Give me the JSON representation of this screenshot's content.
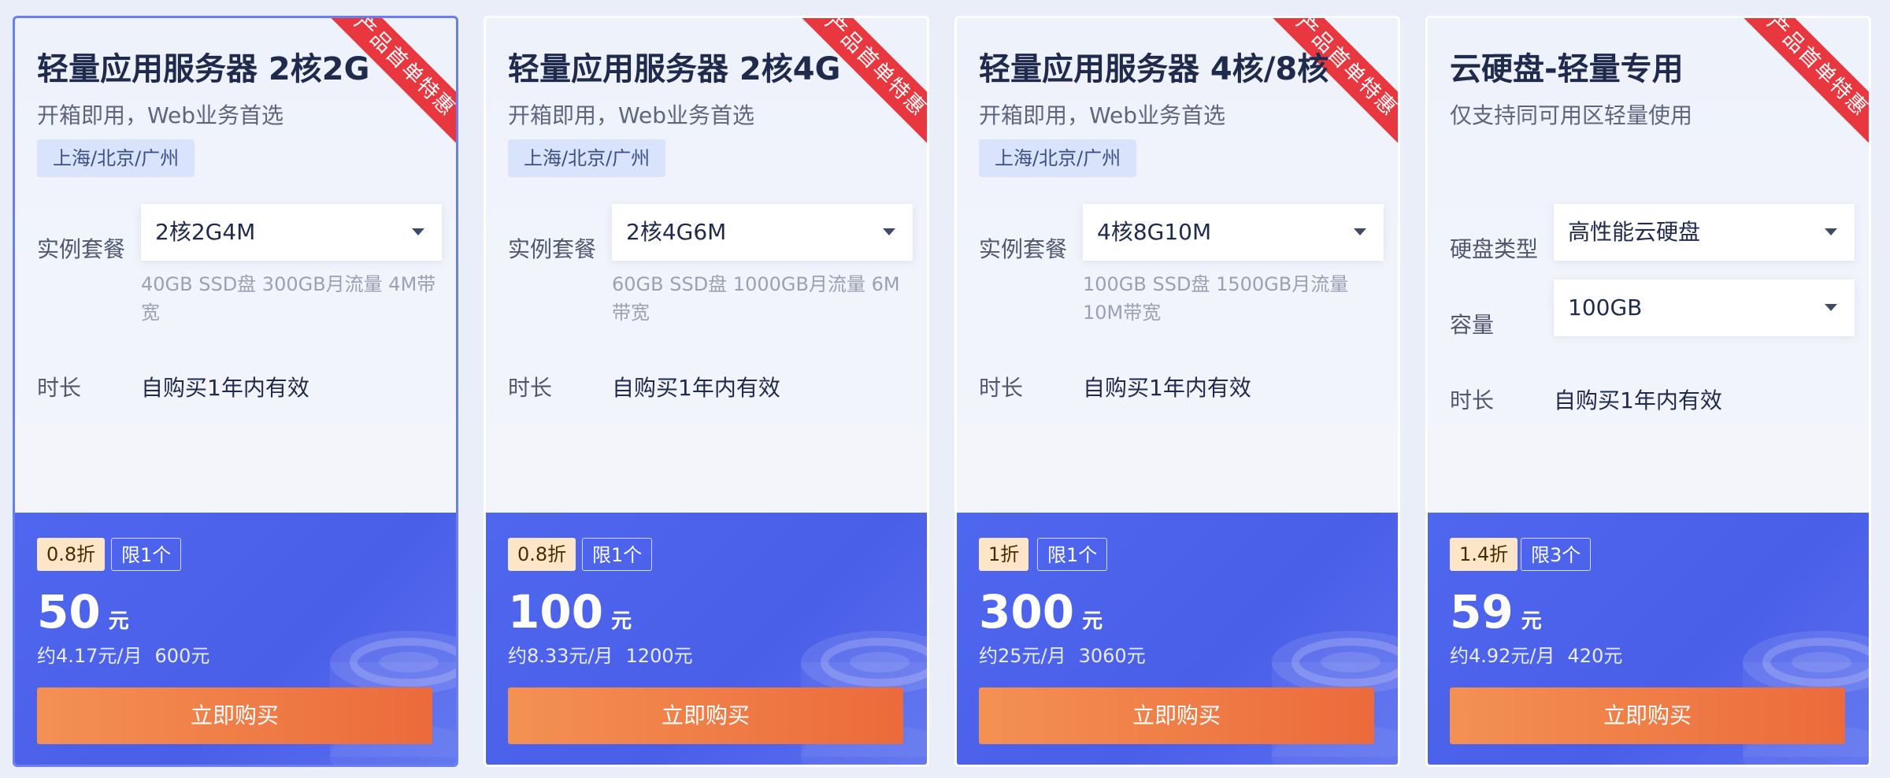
{
  "cards": [
    {
      "ribbon": "产品首单特惠",
      "title": "轻量应用服务器 2核2G",
      "subtitle": "开箱即用，Web业务首选",
      "region": "上海/北京/广州",
      "fields": [
        {
          "label": "实例套餐",
          "value": "2核2G4M"
        }
      ],
      "spec": "40GB SSD盘 300GB月流量 4M带宽",
      "duration_label": "时长",
      "duration_value": "自购买1年内有效",
      "discount": "0.8折",
      "limit": "限1个",
      "price": "50",
      "price_unit": "元",
      "monthly": "约4.17元/月",
      "original": "600元",
      "buy_label": "立即购买"
    },
    {
      "ribbon": "产品首单特惠",
      "title": "轻量应用服务器 2核4G",
      "subtitle": "开箱即用，Web业务首选",
      "region": "上海/北京/广州",
      "fields": [
        {
          "label": "实例套餐",
          "value": "2核4G6M"
        }
      ],
      "spec": "60GB SSD盘 1000GB月流量 6M带宽",
      "duration_label": "时长",
      "duration_value": "自购买1年内有效",
      "discount": "0.8折",
      "limit": "限1个",
      "price": "100",
      "price_unit": "元",
      "monthly": "约8.33元/月",
      "original": "1200元",
      "buy_label": "立即购买"
    },
    {
      "ribbon": "产品首单特惠",
      "title": "轻量应用服务器 4核/8核",
      "subtitle": "开箱即用，Web业务首选",
      "region": "上海/北京/广州",
      "fields": [
        {
          "label": "实例套餐",
          "value": "4核8G10M"
        }
      ],
      "spec": "100GB SSD盘 1500GB月流量 10M带宽",
      "duration_label": "时长",
      "duration_value": "自购买1年内有效",
      "discount": "1折",
      "limit": "限1个",
      "price": "300",
      "price_unit": "元",
      "monthly": "约25元/月",
      "original": "3060元",
      "buy_label": "立即购买"
    },
    {
      "ribbon": "产品首单特惠",
      "title": "云硬盘-轻量专用",
      "subtitle": "仅支持同可用区轻量使用",
      "region": "",
      "fields": [
        {
          "label": "硬盘类型",
          "value": "高性能云硬盘"
        },
        {
          "label": "容量",
          "value": "100GB"
        }
      ],
      "spec": "",
      "duration_label": "时长",
      "duration_value": "自购买1年内有效",
      "discount": "1.4折",
      "limit": "限3个",
      "price": "59",
      "price_unit": "元",
      "monthly": "约4.92元/月",
      "original": "420元",
      "buy_label": "立即购买"
    }
  ],
  "icons": {
    "select_caret": "chevron-down-icon",
    "decoration": "cloud-disk-icon"
  },
  "colors": {
    "accent_blue": "#4f66ee",
    "ribbon_red": "#e8373f",
    "buy_orange": "#ec6a3b",
    "active_border": "#6a7ef0"
  }
}
